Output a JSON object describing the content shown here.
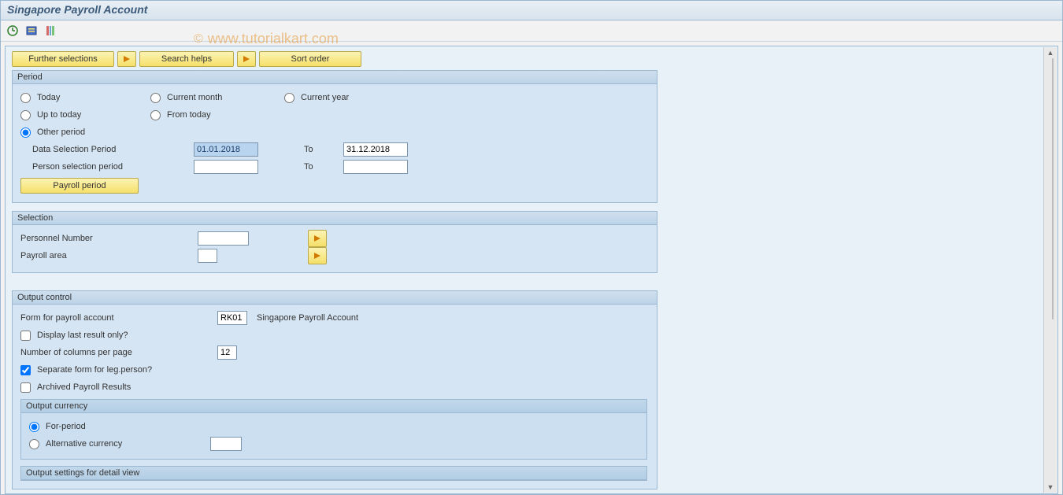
{
  "title": "Singapore Payroll Account",
  "watermark_text": "www.tutorialkart.com",
  "buttons": {
    "further_selections": "Further selections",
    "search_helps": "Search helps",
    "sort_order": "Sort order",
    "payroll_period": "Payroll period"
  },
  "period": {
    "title": "Period",
    "today": "Today",
    "current_month": "Current month",
    "current_year": "Current year",
    "up_to_today": "Up to today",
    "from_today": "From today",
    "other_period": "Other period",
    "data_selection_label": "Data Selection Period",
    "person_selection_label": "Person selection period",
    "to_label": "To",
    "from_date": "01.01.2018",
    "to_date": "31.12.2018",
    "person_from": "",
    "person_to": ""
  },
  "selection": {
    "title": "Selection",
    "personnel_number": "Personnel Number",
    "payroll_area": "Payroll area",
    "personnel_value": "",
    "payroll_area_value": ""
  },
  "output": {
    "title": "Output control",
    "form_label": "Form for payroll account",
    "form_value": "RK01",
    "form_desc": "Singapore Payroll Account",
    "display_last": "Display last result only?",
    "num_cols_label": "Number of columns per page",
    "num_cols_value": "12",
    "separate_form": "Separate form for leg.person?",
    "archived": "Archived Payroll Results",
    "currency_title": "Output currency",
    "for_period": "For-period",
    "alt_currency": "Alternative currency",
    "alt_currency_value": "",
    "detail_title": "Output settings for detail view"
  }
}
